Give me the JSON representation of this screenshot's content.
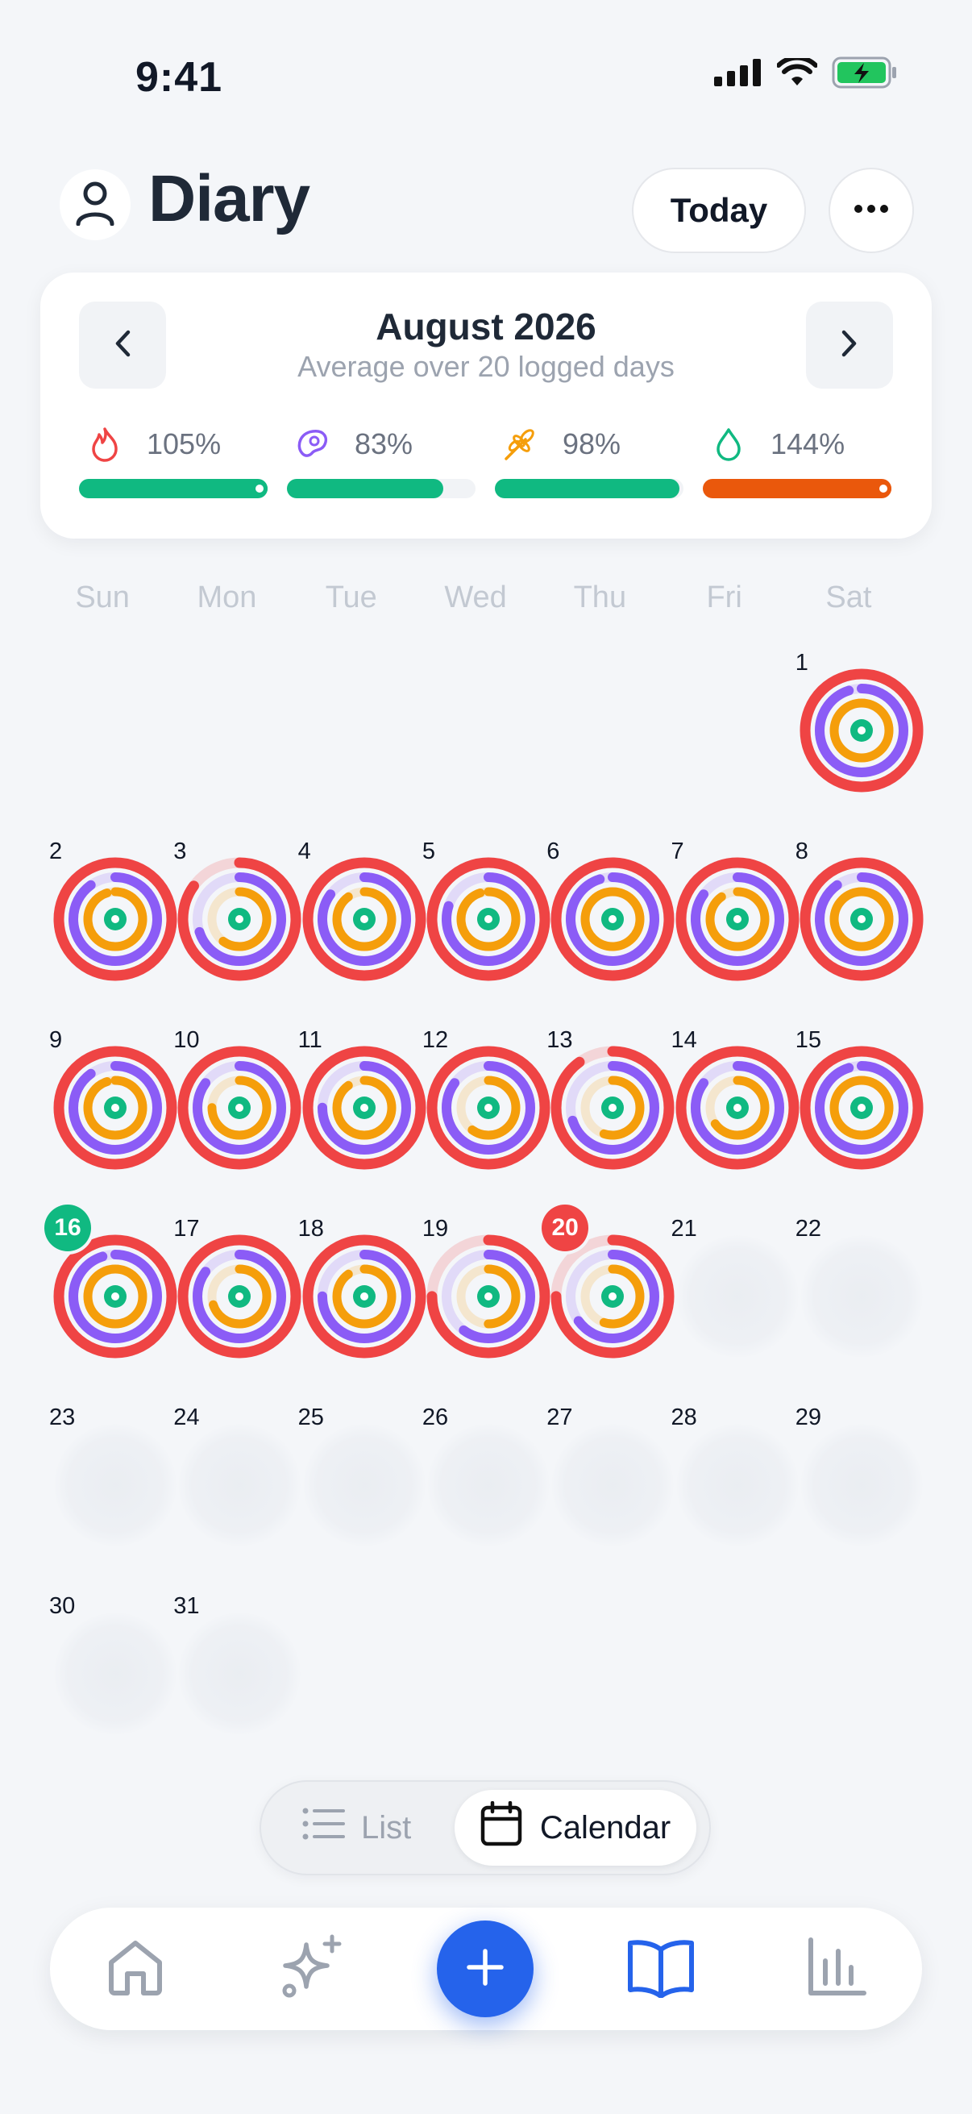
{
  "status_bar": {
    "time": "9:41"
  },
  "header": {
    "title": "Diary",
    "today_label": "Today"
  },
  "summary": {
    "month_title": "August 2026",
    "subtitle": "Average over 20 logged days",
    "metrics": [
      {
        "name": "calories",
        "icon": "flame-icon",
        "percent_label": "105%",
        "fraction": 1.0,
        "color": "#10b981",
        "icon_color": "#ef4444",
        "overflow": true
      },
      {
        "name": "protein",
        "icon": "steak-icon",
        "percent_label": "83%",
        "fraction": 0.83,
        "color": "#10b981",
        "icon_color": "#8b5cf6",
        "overflow": false
      },
      {
        "name": "carbs",
        "icon": "wheat-icon",
        "percent_label": "98%",
        "fraction": 0.98,
        "color": "#10b981",
        "icon_color": "#f59e0b",
        "overflow": false
      },
      {
        "name": "fat",
        "icon": "drop-icon",
        "percent_label": "144%",
        "fraction": 1.0,
        "color": "#ea580c",
        "icon_color": "#10b981",
        "overflow": true
      }
    ]
  },
  "weekdays": [
    "Sun",
    "Mon",
    "Tue",
    "Wed",
    "Thu",
    "Fri",
    "Sat"
  ],
  "calendar": {
    "first_weekday": 6,
    "days_in_month": 31,
    "days": [
      {
        "day": 1,
        "logged": true,
        "rings": [
          1.0,
          0.95,
          1.0,
          0.9
        ]
      },
      {
        "day": 2,
        "logged": true,
        "rings": [
          1.0,
          0.9,
          0.95,
          1.0
        ]
      },
      {
        "day": 3,
        "logged": true,
        "rings": [
          0.85,
          0.7,
          0.6,
          1.0
        ]
      },
      {
        "day": 4,
        "logged": true,
        "rings": [
          1.0,
          0.85,
          0.9,
          1.0
        ]
      },
      {
        "day": 5,
        "logged": true,
        "rings": [
          1.0,
          0.8,
          0.95,
          0.9
        ]
      },
      {
        "day": 6,
        "logged": true,
        "rings": [
          1.0,
          0.95,
          1.0,
          1.0
        ]
      },
      {
        "day": 7,
        "logged": true,
        "rings": [
          1.0,
          0.85,
          0.9,
          1.0
        ]
      },
      {
        "day": 8,
        "logged": true,
        "rings": [
          1.0,
          0.9,
          1.0,
          1.0
        ]
      },
      {
        "day": 9,
        "logged": true,
        "rings": [
          1.0,
          0.9,
          0.95,
          0.95
        ]
      },
      {
        "day": 10,
        "logged": true,
        "rings": [
          1.0,
          0.85,
          0.75,
          1.0
        ]
      },
      {
        "day": 11,
        "logged": true,
        "rings": [
          1.0,
          0.75,
          0.9,
          1.0
        ]
      },
      {
        "day": 12,
        "logged": true,
        "rings": [
          1.0,
          0.85,
          0.6,
          1.0
        ]
      },
      {
        "day": 13,
        "logged": true,
        "rings": [
          0.9,
          0.7,
          0.55,
          1.0
        ]
      },
      {
        "day": 14,
        "logged": true,
        "rings": [
          1.0,
          0.85,
          0.65,
          0.9
        ]
      },
      {
        "day": 15,
        "logged": true,
        "rings": [
          1.0,
          0.95,
          1.0,
          1.0
        ]
      },
      {
        "day": 16,
        "logged": true,
        "rings": [
          1.0,
          0.95,
          1.0,
          1.0
        ],
        "badge": "#10b981"
      },
      {
        "day": 17,
        "logged": true,
        "rings": [
          1.0,
          0.85,
          0.7,
          1.0
        ]
      },
      {
        "day": 18,
        "logged": true,
        "rings": [
          1.0,
          0.75,
          0.9,
          1.0
        ]
      },
      {
        "day": 19,
        "logged": true,
        "rings": [
          0.75,
          0.6,
          0.5,
          1.0
        ]
      },
      {
        "day": 20,
        "logged": true,
        "rings": [
          0.75,
          0.65,
          0.55,
          1.0
        ],
        "badge": "#ef4444"
      },
      {
        "day": 21,
        "logged": false
      },
      {
        "day": 22,
        "logged": false
      },
      {
        "day": 23,
        "logged": false
      },
      {
        "day": 24,
        "logged": false
      },
      {
        "day": 25,
        "logged": false
      },
      {
        "day": 26,
        "logged": false
      },
      {
        "day": 27,
        "logged": false
      },
      {
        "day": 28,
        "logged": false
      },
      {
        "day": 29,
        "logged": false
      },
      {
        "day": 30,
        "logged": false
      },
      {
        "day": 31,
        "logged": false
      }
    ],
    "ring_colors": [
      "#ef4444",
      "#8b5cf6",
      "#f59e0b",
      "#10b981"
    ]
  },
  "view_toggle": {
    "list_label": "List",
    "calendar_label": "Calendar",
    "selected": "Calendar"
  },
  "tabbar": {
    "items": [
      {
        "name": "home",
        "icon": "home-icon",
        "active": false
      },
      {
        "name": "ai",
        "icon": "sparkles-icon",
        "active": false
      },
      {
        "name": "add",
        "icon": "plus-icon",
        "active": false
      },
      {
        "name": "diary",
        "icon": "book-icon",
        "active": true
      },
      {
        "name": "stats",
        "icon": "bar-chart-icon",
        "active": false
      }
    ],
    "active_color": "#2563eb",
    "inactive_color": "#9ca3af"
  }
}
